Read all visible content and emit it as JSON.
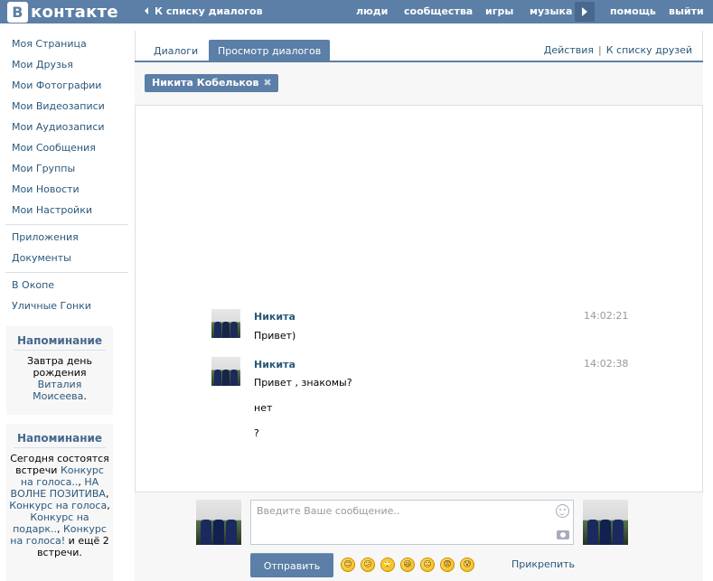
{
  "header": {
    "logo_letter": "В",
    "logo_text": "контакте",
    "back_link": "К списку диалогов",
    "nav": [
      "люди",
      "сообщества",
      "игры",
      "музыка",
      "помощь",
      "выйти"
    ]
  },
  "sidebar": {
    "items": [
      "Моя Страница",
      "Мои Друзья",
      "Мои Фотографии",
      "Мои Видеозаписи",
      "Мои Аудиозаписи",
      "Мои Сообщения",
      "Мои Группы",
      "Мои Новости",
      "Мои Настройки"
    ],
    "apps": [
      "Приложения",
      "Документы"
    ],
    "groups": [
      "В Окопе",
      "Уличные Гонки"
    ]
  },
  "reminder1": {
    "title": "Напоминание",
    "t1": "Завтра ",
    "l1": "день рождения",
    "t2": " ",
    "l2": "Виталия Моисеева",
    "t3": "."
  },
  "reminder2": {
    "title": "Напоминание",
    "t1": "Сегодня ",
    "l1": "состоятся встречи",
    "t2": " ",
    "l2": "Конкурс на голоса..",
    "t3": ", ",
    "l3": "НА ВОЛНЕ ПОЗИТИВА",
    "t4": ", ",
    "l4": "Конкурс на голоса",
    "t5": ", ",
    "l5": "Конкурс на подарк..",
    "t6": ", ",
    "l6": "Конкурс на голоса!",
    "t7": " и ещё 2 встречи."
  },
  "tabs": {
    "dialogs": "Диалоги",
    "view": "Просмотр диалогов",
    "actions": "Действия",
    "separator": "|",
    "friends": "К списку друзей"
  },
  "peer": {
    "name": "Никита Кобельков",
    "remove": "✖"
  },
  "messages": [
    {
      "author": "Никита",
      "time": "14:02:21",
      "lines": [
        "Привет)"
      ]
    },
    {
      "author": "Никита",
      "time": "14:02:38",
      "lines": [
        "Привет , знакомы?",
        "нет",
        "?"
      ]
    }
  ],
  "composer": {
    "placeholder": "Введите Ваше сообщение..",
    "send": "Отправить",
    "attach": "Прикрепить",
    "emojis": [
      "😊",
      "😕",
      "🙄",
      "😆",
      "😐",
      "😨",
      "😰"
    ]
  },
  "colors": {
    "brand": "#5b7fa6",
    "link": "#2b587a",
    "panel": "#f7f7f7"
  }
}
